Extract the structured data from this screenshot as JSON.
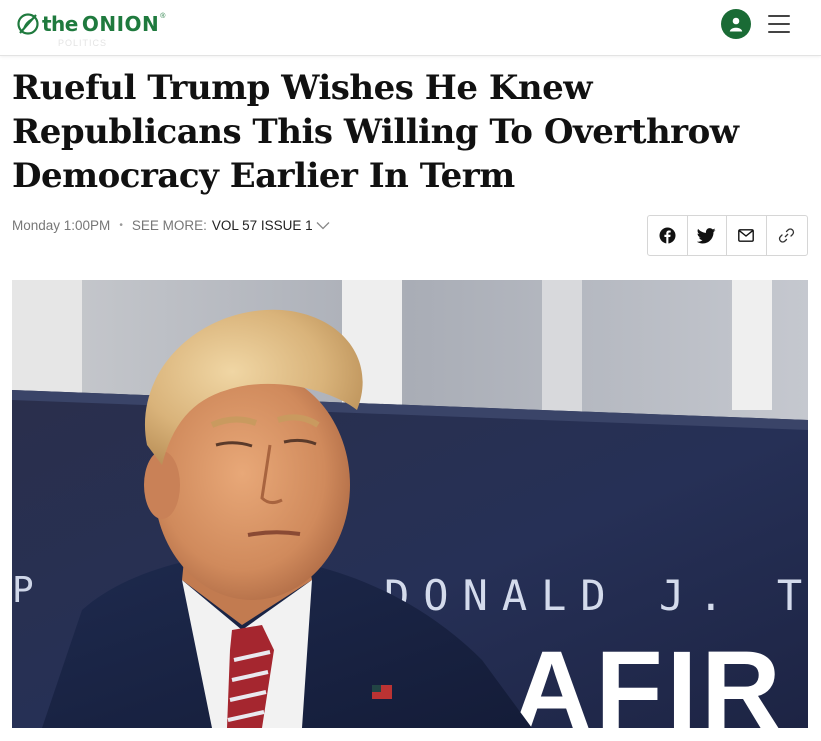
{
  "site": {
    "logo_the": "the",
    "logo_onion": "ONION",
    "logo_reg": "®"
  },
  "header": {
    "ghost_nav": "POLITICS"
  },
  "article": {
    "headline": "Rueful Trump Wishes He Knew Republicans This Willing To Overthrow Democracy Earlier In Term",
    "timestamp": "Monday 1:00PM",
    "see_more_label": "SEE MORE:",
    "issue_label": "VOL 57 ISSUE 1"
  },
  "share": {
    "icons": [
      "facebook-icon",
      "twitter-icon",
      "email-icon",
      "link-icon"
    ]
  },
  "hero": {
    "backdrop_text": "DONALD J. T",
    "backdrop_text_partial": "P",
    "backdrop_big": "AFIR"
  },
  "colors": {
    "brand_green": "#1f7a3e",
    "avatar_bg": "#1a6b35",
    "backdrop_navy": "#2b3150"
  }
}
